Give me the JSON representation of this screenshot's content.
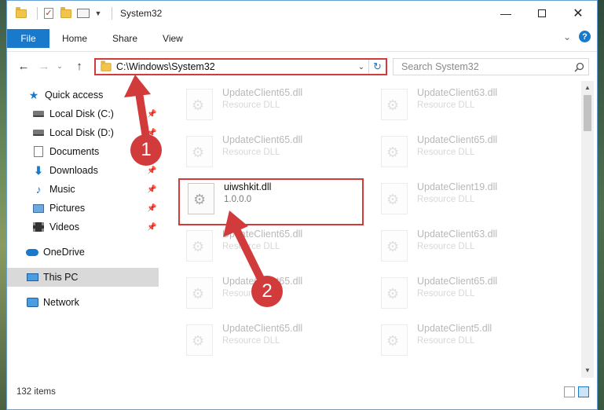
{
  "window": {
    "title": "System32",
    "controls": {
      "minimize": "—",
      "maximize": "",
      "close": "✕"
    }
  },
  "ribbon": {
    "file_tab": "File",
    "tabs": [
      "Home",
      "Share",
      "View"
    ],
    "expand_icon": "chevron-down-icon",
    "help_label": "?"
  },
  "address_bar": {
    "path": "C:\\Windows\\System32",
    "search_placeholder": "Search System32"
  },
  "nav_pane": {
    "quick_access": "Quick access",
    "items": [
      {
        "label": "Local Disk (C:)",
        "icon": "drive-icon",
        "pinned": true
      },
      {
        "label": "Local Disk (D:)",
        "icon": "drive-icon",
        "pinned": true
      },
      {
        "label": "Documents",
        "icon": "documents-icon",
        "pinned": true
      },
      {
        "label": "Downloads",
        "icon": "downloads-icon",
        "pinned": true
      },
      {
        "label": "Music",
        "icon": "music-icon",
        "pinned": true
      },
      {
        "label": "Pictures",
        "icon": "pictures-icon",
        "pinned": true
      },
      {
        "label": "Videos",
        "icon": "videos-icon",
        "pinned": true
      }
    ],
    "onedrive": "OneDrive",
    "this_pc": "This PC",
    "network": "Network"
  },
  "files": {
    "left_column": [
      {
        "name": "UpdateClient65.dll",
        "desc": "Resource DLL"
      },
      {
        "name": "UpdateClient65.dll",
        "desc": "Resource DLL"
      },
      {
        "name": "uiwshkit.dll",
        "desc": "1.0.0.0",
        "highlighted": true
      },
      {
        "name": "UpdateClient65.dll",
        "desc": "Resource DLL"
      },
      {
        "name": "UpdateClient65.dll",
        "desc": "Resource DLL"
      },
      {
        "name": "UpdateClient65.dll",
        "desc": "Resource DLL"
      }
    ],
    "right_column": [
      {
        "name": "UpdateClient63.dll",
        "desc": "Resource DLL"
      },
      {
        "name": "UpdateClient65.dll",
        "desc": "Resource DLL"
      },
      {
        "name": "UpdateClient19.dll",
        "desc": "Resource DLL"
      },
      {
        "name": "UpdateClient63.dll",
        "desc": "Resource DLL"
      },
      {
        "name": "UpdateClient65.dll",
        "desc": "Resource DLL"
      },
      {
        "name": "UpdateClient5.dll",
        "desc": "Resource DLL"
      }
    ]
  },
  "status_bar": {
    "item_count": "132 items"
  },
  "annotations": {
    "step1": "1",
    "step2": "2",
    "color": "#d23b3b"
  },
  "colors": {
    "accent": "#1979ca",
    "highlight_border": "#d23b3b"
  }
}
